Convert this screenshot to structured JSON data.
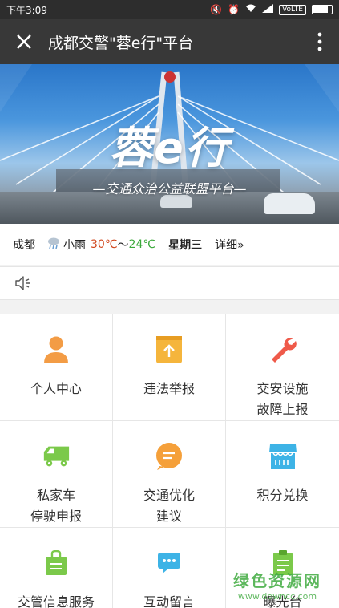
{
  "status_bar": {
    "time": "下午3:09",
    "network": "VoLTE"
  },
  "title_bar": {
    "title": "成都交警\"蓉e行\"平台"
  },
  "banner": {
    "logo": "蓉e行",
    "slogan": "—交通众治公益联盟平台—"
  },
  "weather": {
    "city": "成都",
    "icon": "rain-cloud-icon",
    "condition": "小雨",
    "high": "30℃",
    "tilde": "～",
    "low": "24℃",
    "weekday": "星期三",
    "detail": "详细»"
  },
  "notice": {
    "icon": "speaker-icon"
  },
  "grid": [
    {
      "label": "个人中心",
      "icon": "person-icon",
      "color": "#f39c45"
    },
    {
      "label": "违法举报",
      "icon": "upload-box-icon",
      "color": "#f5b53c"
    },
    {
      "label": "交安设施\n故障上报",
      "icon": "wrench-icon",
      "color": "#ef5a4a"
    },
    {
      "label": "私家车\n停驶申报",
      "icon": "car-icon",
      "color": "#7bc94a"
    },
    {
      "label": "交通优化\n建议",
      "icon": "chat-bubble-icon",
      "color": "#f5a03a"
    },
    {
      "label": "积分兑换",
      "icon": "shop-icon",
      "color": "#3db3e6"
    },
    {
      "label": "交管信息服务",
      "icon": "bag-icon",
      "color": "#7bc94a"
    },
    {
      "label": "互动留言",
      "icon": "message-icon",
      "color": "#3db3e6"
    },
    {
      "label": "曝光台",
      "icon": "document-icon",
      "color": "#7bc94a"
    }
  ],
  "watermark": {
    "line1": "绿色资源网",
    "line2": "www.downcc.com"
  },
  "colors": {
    "title_bar": "#383838",
    "status_bar": "#2d2d2d",
    "temp_high": "#d0451b",
    "temp_low": "#3aa83a"
  }
}
